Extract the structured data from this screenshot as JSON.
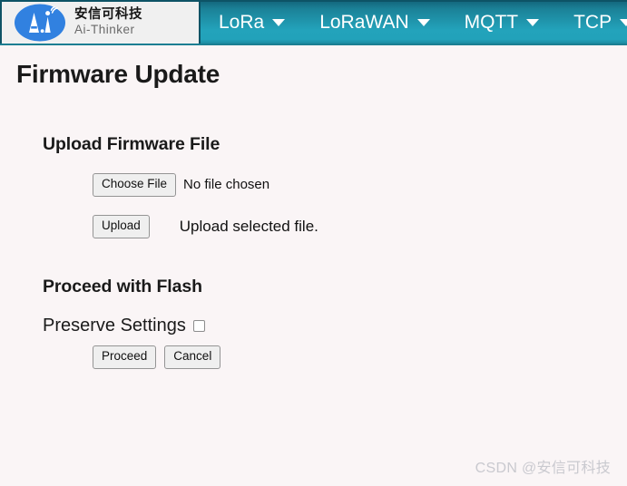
{
  "navbar": {
    "brand": {
      "logo_icon": "ai-thinker-logo-icon",
      "name_cn": "安信可科技",
      "name_en": "Ai-Thinker"
    },
    "items": [
      {
        "label": "LoRa",
        "caret_icon": "chevron-down-icon"
      },
      {
        "label": "LoRaWAN",
        "caret_icon": "chevron-down-icon"
      },
      {
        "label": "MQTT",
        "caret_icon": "chevron-down-icon"
      },
      {
        "label": "TCP",
        "caret_icon": "chevron-down-icon"
      }
    ],
    "colors": {
      "gradient_top": "#14697f",
      "gradient_bottom": "#23a3bb",
      "border": "#0d5366",
      "brand_bg": "#f0f0f0",
      "text": "#ffffff"
    }
  },
  "page": {
    "title": "Firmware Update",
    "background": "#faf5f6"
  },
  "upload_section": {
    "heading": "Upload Firmware File",
    "choose_file_label": "Choose File",
    "file_status": "No file chosen",
    "upload_label": "Upload",
    "upload_hint": "Upload selected file."
  },
  "flash_section": {
    "heading": "Proceed with Flash",
    "preserve_label": "Preserve Settings",
    "preserve_checked": false,
    "proceed_label": "Proceed",
    "cancel_label": "Cancel"
  },
  "watermark": {
    "text": "CSDN @安信可科技"
  }
}
